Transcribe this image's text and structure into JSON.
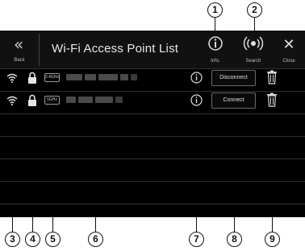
{
  "header": {
    "back_label": "Back",
    "title": "Wi-Fi Access Point List",
    "info_label": "Info.",
    "search_label": "Search",
    "close_label": "Close"
  },
  "rows": [
    {
      "band": "2.4GHz",
      "button": "Disconnect",
      "wifi_icon": "wifi-icon",
      "lock_icon": "lock-icon",
      "info_icon": "info-icon",
      "delete_icon": "trash-icon"
    },
    {
      "band": "5GHz",
      "button": "Connect",
      "wifi_icon": "wifi-icon",
      "lock_icon": "lock-icon",
      "info_icon": "info-icon",
      "delete_icon": "trash-icon"
    }
  ],
  "callouts": [
    "1",
    "2",
    "3",
    "4",
    "5",
    "6",
    "7",
    "8",
    "9"
  ],
  "colors": {
    "screen_background": "#000000",
    "header_background": "#111111",
    "text": "#e8e8e8",
    "grid_lines": "#2f2f2f",
    "button_border": "#6a6a6a",
    "callout_ink": "#111111"
  }
}
